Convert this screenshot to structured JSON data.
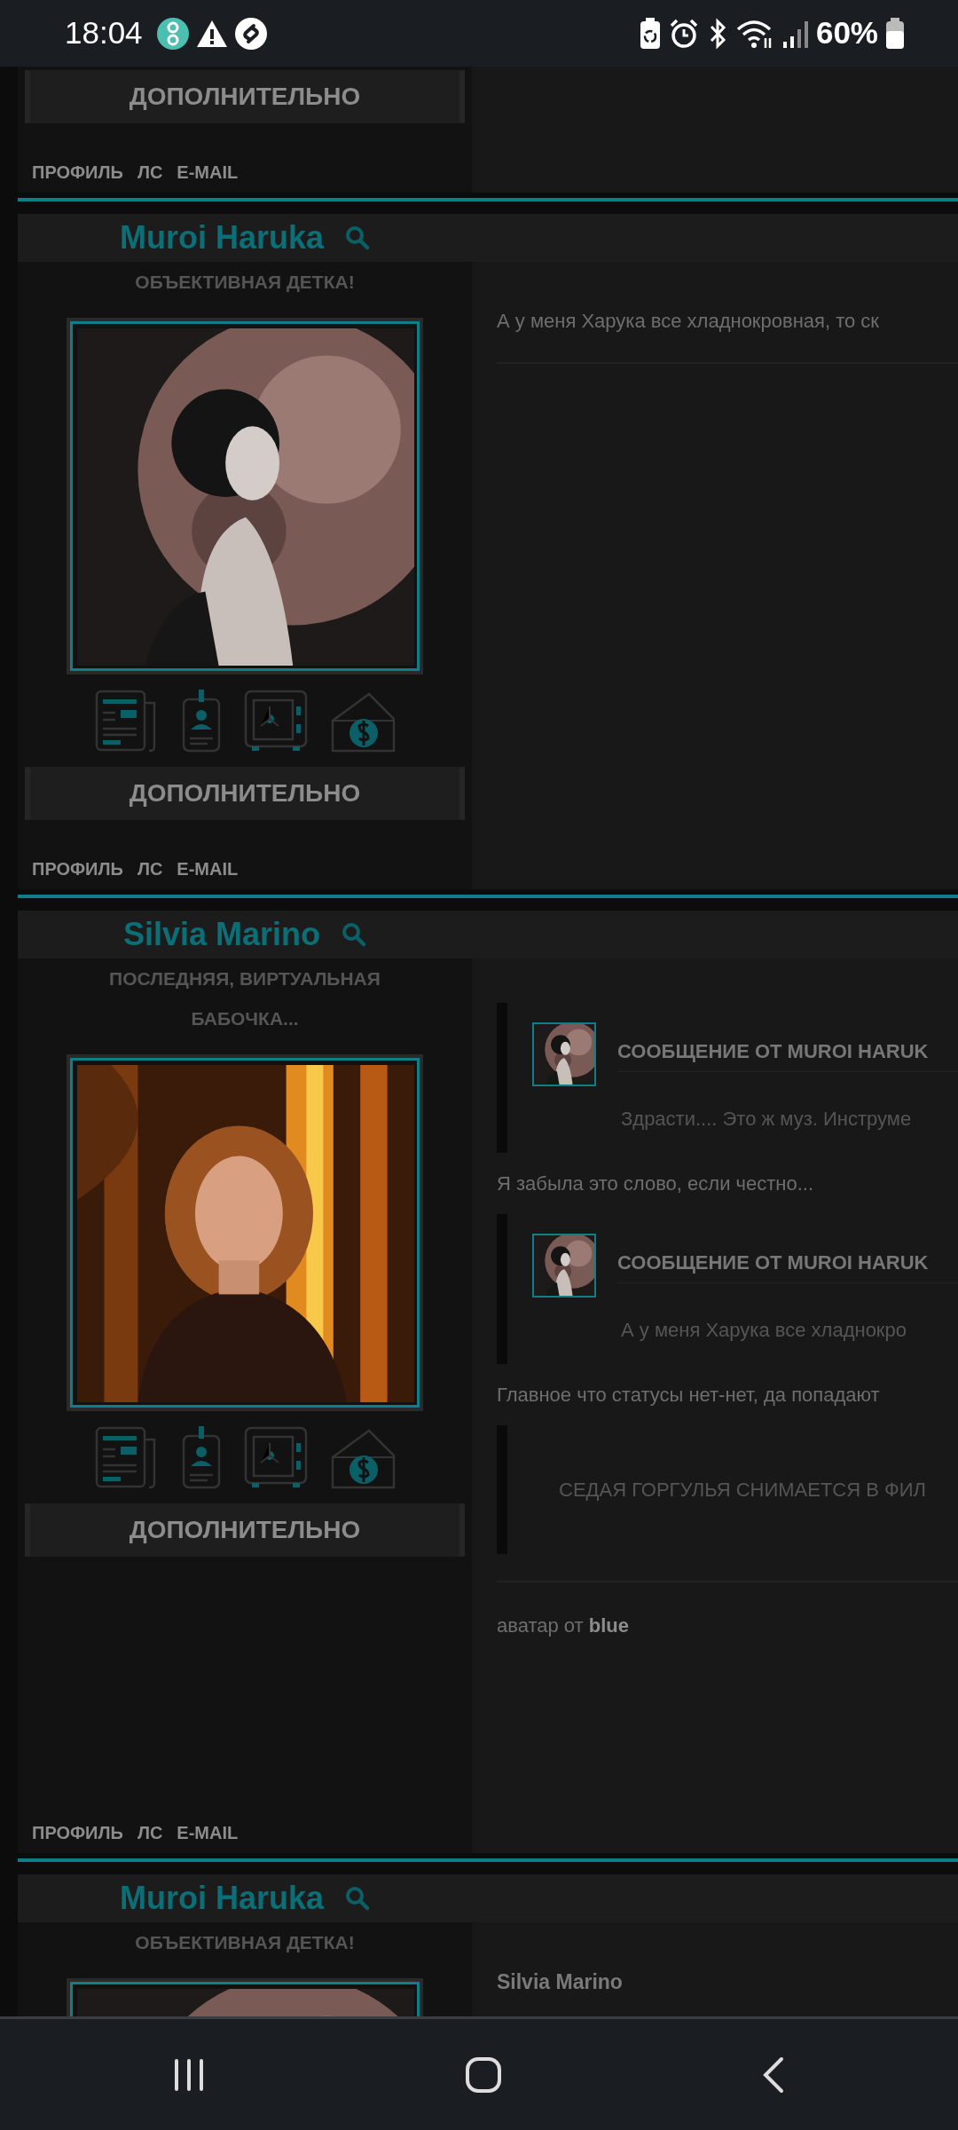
{
  "status_bar": {
    "time": "18:04",
    "battery": "60%"
  },
  "posts": [
    {
      "kind": "continued",
      "more_button": "ДОПОЛНИТЕЛЬНО",
      "links": [
        "ПРОФИЛЬ",
        "ЛС",
        "E-MAIL"
      ]
    },
    {
      "kind": "post",
      "author": "Muroi Haruka",
      "status": "ОБЪЕКТИВНАЯ ДЕТКА!",
      "avatar": {
        "kind": "picture"
      },
      "more_button": "ДОПОЛНИТЕЛЬНО",
      "links": [
        "ПРОФИЛЬ",
        "ЛС",
        "E-MAIL"
      ],
      "body": [
        {
          "kind": "paragraph",
          "text": "А у меня Харука все хладнокровная, то ск"
        },
        {
          "kind": "divider"
        }
      ]
    },
    {
      "kind": "post",
      "author": "Silvia Marino",
      "status": "ПОСЛЕДНЯЯ, ВИРТУАЛЬНАЯ БАБОЧКА...",
      "avatar": {
        "kind": "picture"
      },
      "more_button": "ДОПОЛНИТЕЛЬНО",
      "links": [
        "ПРОФИЛЬ",
        "ЛС",
        "E-MAIL"
      ],
      "body": [
        {
          "kind": "quote",
          "thumb": {
            "kind": "picture"
          },
          "header": "СООБЩЕНИЕ ОТ MUROI HARUK",
          "text": "Здрасти.... Это ж муз. Инструме"
        },
        {
          "kind": "paragraph",
          "text": "Я забыла это слово, если честно..."
        },
        {
          "kind": "quote",
          "thumb": {
            "kind": "picture"
          },
          "header": "СООБЩЕНИЕ ОТ MUROI HARUK",
          "text": "А у меня Харука все хладнокро"
        },
        {
          "kind": "paragraph",
          "text": "Главное что статусы нет-нет, да попадают"
        },
        {
          "kind": "quote",
          "text": "СЕДАЯ ГОРГУЛЬЯ СНИМАЕТСЯ В ФИЛ"
        },
        {
          "kind": "divider"
        },
        {
          "kind": "signature",
          "text": "аватар от **blue**"
        }
      ]
    },
    {
      "kind": "post",
      "author": "Muroi Haruka",
      "status": "ОБЪЕКТИВНАЯ ДЕТКА!",
      "avatar": {
        "kind": "picture"
      },
      "body": [
        {
          "kind": "heading",
          "text": "Silvia Marino"
        }
      ]
    }
  ]
}
